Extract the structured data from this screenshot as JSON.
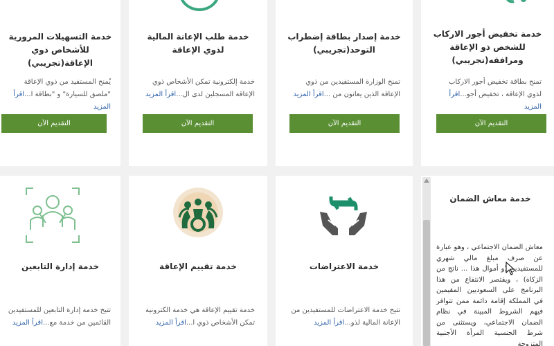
{
  "cards_top": [
    {
      "title": "خدمة التسهيلات المرورية للأشخاص ذوي الإعاقة(تجريبي)",
      "desc": "يُمنح المستفيد من ذوي الإعاقة \"ملصق للسيارة\" و \"بطاقة ا...",
      "more": "اقرأ المزيد",
      "button": "التقديم الآن"
    },
    {
      "title": "خدمة طلب الإعانة المالية لذوي الإعاقة",
      "desc": "خدمة إلكترونية تمكن الأشخاص ذوي الإعاقة المسجلين لدى ال...",
      "more": "اقرأ المزيد",
      "button": "التقديم الآن"
    },
    {
      "title": "خدمة إصدار بطاقة إضطراب التوحد(تجريبي)",
      "desc": "تمنح الوزارة المستفيدين من ذوي الإعاقة الذين يعانون من ...",
      "more": "اقرأ المزيد",
      "button": "التقديم الآن"
    },
    {
      "title": "خدمة تخفيض أجور الاركاب للشخص ذو الإعاقة ومرافقه(تجريبي)",
      "desc": "تمنح بطاقة تخفيض أجور الاركاب لذوي الإعاقة ، تخفيض أجو...",
      "more": "اقرأ المزيد",
      "button": "التقديم الآن"
    }
  ],
  "cards_bottom": [
    {
      "title": "خدمة إدارة التابعين",
      "desc": "تتيح خدمة إدارة التابعين للمستفيدين القائمين من خدمة مع...",
      "more": "اقرأ المزيد",
      "icon": "family-dependents-icon"
    },
    {
      "title": "خدمة تقييم الإعاقة",
      "desc": "خدمة تقييم الإعاقة هي خدمة الكترونية تمكن الأشخاص ذوي ا...",
      "more": "اقرأ المزيد",
      "icon": "disability-assessment-icon"
    },
    {
      "title": "خدمة الاعتراضات",
      "desc": "تتيح خدمة الاعتراضات للمستفيدين من الإعانة المالية لذو...",
      "more": "اقرأ المزيد",
      "icon": "hands-exchange-icon"
    }
  ],
  "detail": {
    "title": "خدمة معاش الضمان",
    "text": "معاش الضمان الاجتماعي ، وهو عبارة عن صرف مبلغ مالي شهري للمستفيدين (و أموال هذا ... ناتج من الزكاة) ، ويقتصر الانتفاع من هذا البرنامج على السعوديين المقيمين في المملكة إقامة دائمة ممن تتوافر فيهم الشروط المبينة في نظام الضمان الاجتماعي، ويستثنى من شرط الجنسية المرأة الأجنبية المتزوجة"
  },
  "colors": {
    "button": "#5a8f34",
    "link": "#2b5fa8",
    "icon_dark_green": "#1f6b3d",
    "icon_teal": "#1b8f6a"
  }
}
